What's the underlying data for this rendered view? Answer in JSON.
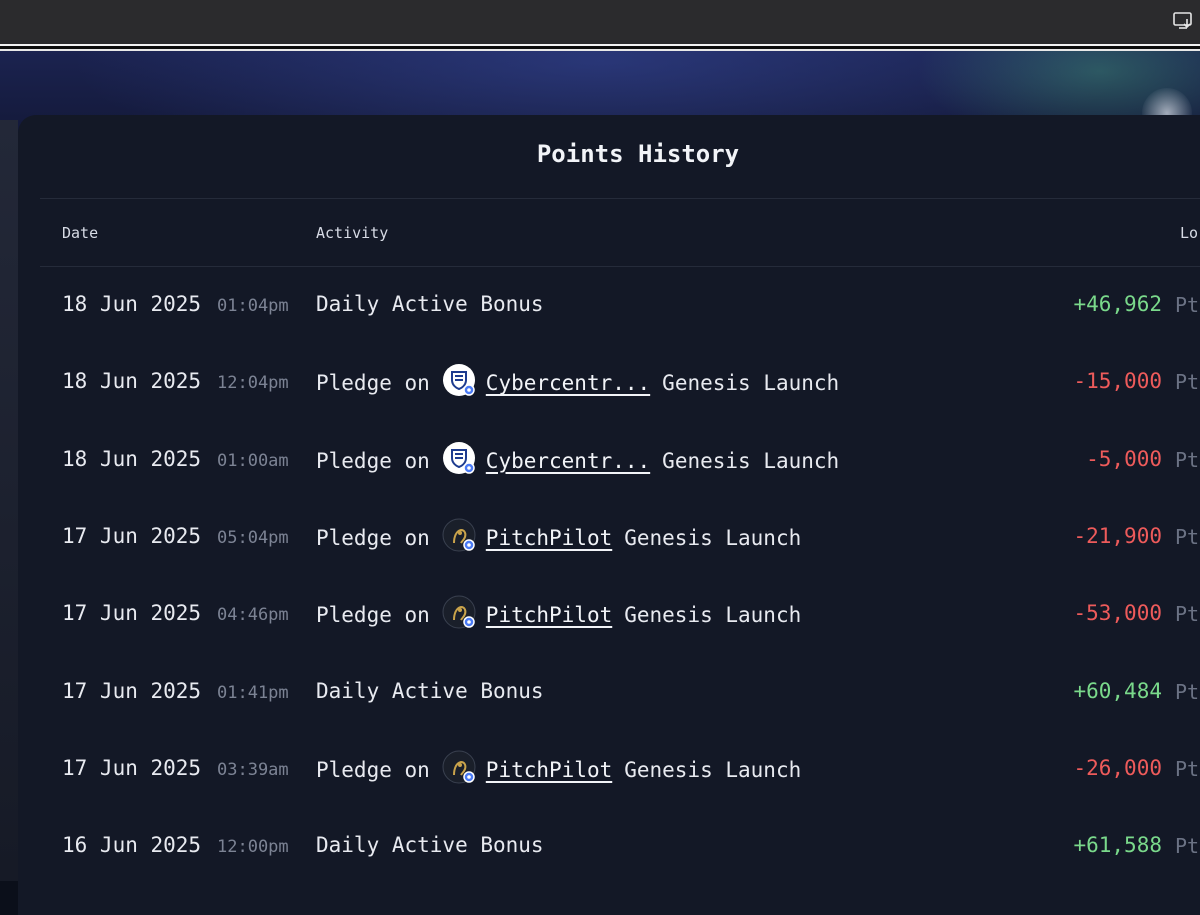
{
  "title": "Points History",
  "columns": {
    "date": "Date",
    "activity": "Activity",
    "amount_partial": "Lo"
  },
  "colors": {
    "positive": "#7ad98b",
    "negative": "#ee5b5b",
    "panel": "#131826"
  },
  "unit": "Pt",
  "rows": [
    {
      "date": "18 Jun 2025",
      "time": "01:04pm",
      "prefix": "Daily Active Bonus",
      "project": "",
      "suffix": "",
      "icon": "",
      "amount": "+46,962",
      "sign": "pos"
    },
    {
      "date": "18 Jun 2025",
      "time": "12:04pm",
      "prefix": "Pledge on",
      "project": "Cybercentr...",
      "suffix": "Genesis Launch",
      "icon": "cybercentr-logo-icon",
      "amount": "-15,000",
      "sign": "neg"
    },
    {
      "date": "18 Jun 2025",
      "time": "01:00am",
      "prefix": "Pledge on",
      "project": "Cybercentr...",
      "suffix": "Genesis Launch",
      "icon": "cybercentr-logo-icon",
      "amount": "-5,000",
      "sign": "neg"
    },
    {
      "date": "17 Jun 2025",
      "time": "05:04pm",
      "prefix": "Pledge on",
      "project": "PitchPilot",
      "suffix": "Genesis Launch",
      "icon": "pitchpilot-logo-icon",
      "amount": "-21,900",
      "sign": "neg"
    },
    {
      "date": "17 Jun 2025",
      "time": "04:46pm",
      "prefix": "Pledge on",
      "project": "PitchPilot",
      "suffix": "Genesis Launch",
      "icon": "pitchpilot-logo-icon",
      "amount": "-53,000",
      "sign": "neg"
    },
    {
      "date": "17 Jun 2025",
      "time": "01:41pm",
      "prefix": "Daily Active Bonus",
      "project": "",
      "suffix": "",
      "icon": "",
      "amount": "+60,484",
      "sign": "pos"
    },
    {
      "date": "17 Jun 2025",
      "time": "03:39am",
      "prefix": "Pledge on",
      "project": "PitchPilot",
      "suffix": "Genesis Launch",
      "icon": "pitchpilot-logo-icon",
      "amount": "-26,000",
      "sign": "neg"
    },
    {
      "date": "16 Jun 2025",
      "time": "12:00pm",
      "prefix": "Daily Active Bonus",
      "project": "",
      "suffix": "",
      "icon": "",
      "amount": "+61,588",
      "sign": "pos"
    }
  ]
}
